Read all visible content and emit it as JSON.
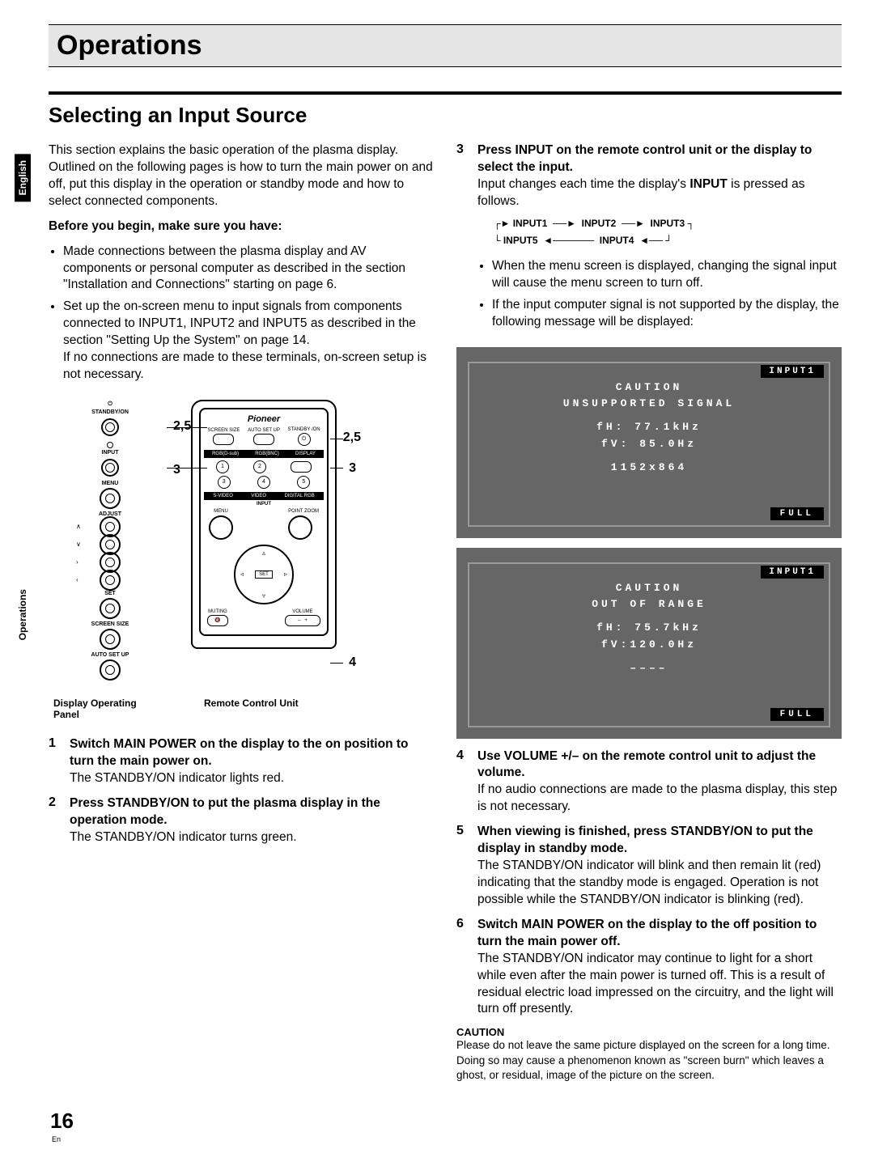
{
  "tabs": {
    "lang": "English",
    "section": "Operations"
  },
  "chapter": "Operations",
  "section": "Selecting an Input Source",
  "intro": "This section explains the basic operation of the plasma display. Outlined on the following pages is how to turn the main power on and off, put this display in the operation or standby mode and how to select connected components.",
  "before_heading": "Before you begin, make sure you have:",
  "before_bullets": [
    "Made connections between the plasma display and AV components or personal computer as described in the section \"Installation and Connections\" starting on page 6.",
    "Set up the on-screen menu to input signals from components connected to INPUT1, INPUT2 and INPUT5 as described in the section \"Setting Up the System\" on page 14."
  ],
  "before_note": "If no connections are made to these terminals, on-screen setup is not necessary.",
  "figure": {
    "panel_labels": [
      "STANDBY/ON",
      "INPUT",
      "MENU",
      "ADJUST",
      "SET",
      "SCREEN SIZE",
      "AUTO SET UP"
    ],
    "panel_callouts": {
      "a": "2,5",
      "b": "3"
    },
    "remote": {
      "brand": "Pioneer",
      "top_row": [
        "SCREEN SIZE",
        "AUTO SET UP",
        "STANDBY /ON"
      ],
      "sub_row": [
        "RGB(D-sub)",
        "RGB(BNC)",
        "DISPLAY"
      ],
      "num_row1": [
        "1",
        "2"
      ],
      "num_row2": [
        "3",
        "4",
        "5"
      ],
      "input_bar": [
        "S-VIDEO",
        "VIDEO",
        "DIGITAL RGB"
      ],
      "input_label": "INPUT",
      "mid_row": [
        "MENU",
        "POINT ZOOM"
      ],
      "set": "SET",
      "bottom_row": [
        "MUTING",
        "VOLUME"
      ]
    },
    "remote_callouts": {
      "a": "2,5",
      "b": "3",
      "c": "4"
    },
    "caption_left": "Display Operating Panel",
    "caption_right": "Remote Control Unit"
  },
  "steps_left": [
    {
      "n": "1",
      "title": "Switch MAIN POWER on the display to the on position to turn the main power on.",
      "body": "The STANDBY/ON indicator lights red."
    },
    {
      "n": "2",
      "title": "Press STANDBY/ON to put the plasma display in the operation mode.",
      "body": "The STANDBY/ON indicator turns green."
    }
  ],
  "step3": {
    "n": "3",
    "title": "Press INPUT on the remote control unit or the display to select the input.",
    "lead": "Input changes each time the display's ",
    "lead_bold": "INPUT",
    "lead_tail": " is pressed as follows.",
    "flow_top": "INPUT1  ──►  INPUT2  ──►  INPUT3",
    "flow_bottom": "INPUT5  ◄──────  INPUT4  ◄──",
    "bullets": [
      "When the menu screen is displayed, changing the signal input will cause the menu screen to turn off.",
      "If the input computer signal is not supported by the display, the following message will be displayed:"
    ]
  },
  "osd1": {
    "badge": "INPUT1",
    "line1": "CAUTION",
    "line2": "UNSUPPORTED SIGNAL",
    "line3": "fH: 77.1kHz",
    "line4": "fV: 85.0Hz",
    "line5": "1152x864",
    "full": "FULL"
  },
  "osd2": {
    "badge": "INPUT1",
    "line1": "CAUTION",
    "line2": "OUT OF RANGE",
    "line3": "fH: 75.7kHz",
    "line4": "fV:120.0Hz",
    "line5": "––––",
    "full": "FULL"
  },
  "steps_right": [
    {
      "n": "4",
      "title": "Use VOLUME +/– on the remote control unit to adjust the volume.",
      "body": "If no audio connections are made to the plasma display, this step is not necessary."
    },
    {
      "n": "5",
      "title": "When viewing is finished, press STANDBY/ON to put the display in standby mode.",
      "body": "The STANDBY/ON indicator will blink and then remain lit (red) indicating that the standby mode is engaged. Operation is not possible while the STANDBY/ON indicator is blinking (red)."
    },
    {
      "n": "6",
      "title": "Switch MAIN POWER on the display to the off position to turn the main power off.",
      "body": "The STANDBY/ON indicator may continue to light for a short while even after the main power is turned off. This is a result of residual electric load impressed on the circuitry, and the light will turn off presently."
    }
  ],
  "caution": {
    "head": "CAUTION",
    "body": "Please do not leave the same picture displayed on the screen for a long time. Doing so may cause a phenomenon known as \"screen burn\" which leaves a ghost, or residual, image of the picture on the screen."
  },
  "page_number": "16",
  "page_lang": "En"
}
